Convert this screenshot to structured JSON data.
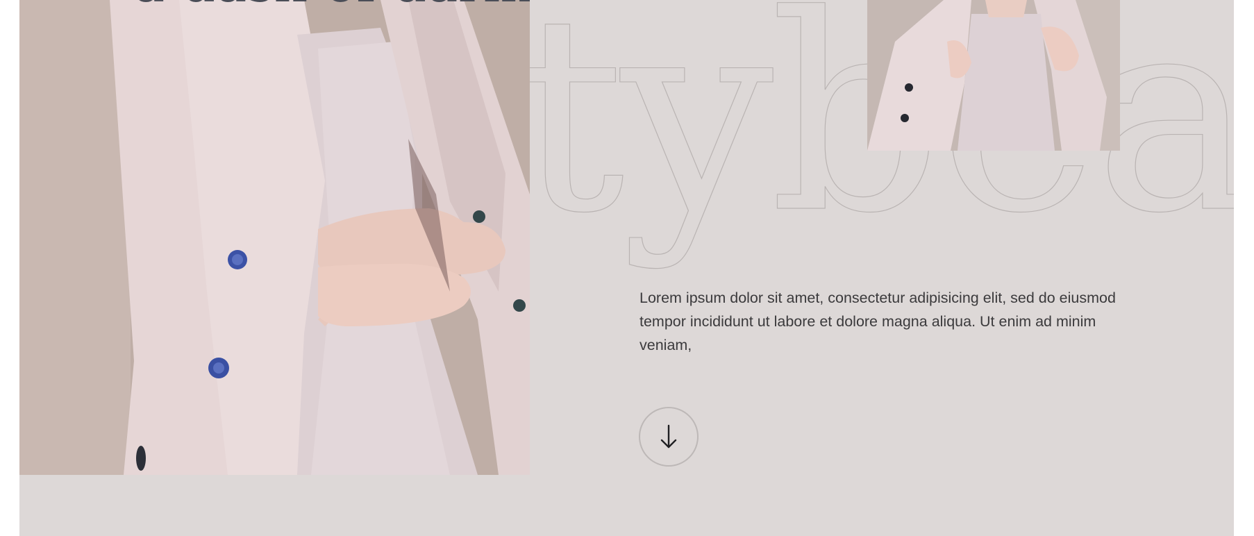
{
  "hero": {
    "heading": "a dash of daring.",
    "background_word": "utybea",
    "description": "Lorem ipsum dolor sit amet, consectetur adipisicing elit, sed do eiusmod tempor incididunt ut labore et dolore magna aliqua. Ut enim ad minim veniam,",
    "scroll_button_icon": "arrow-down-icon"
  },
  "colors": {
    "panel_background": "#ddd8d7",
    "heading_text": "#4a4d57",
    "body_text": "#3b3a3c",
    "outline_stroke": "#b9b3b2"
  }
}
